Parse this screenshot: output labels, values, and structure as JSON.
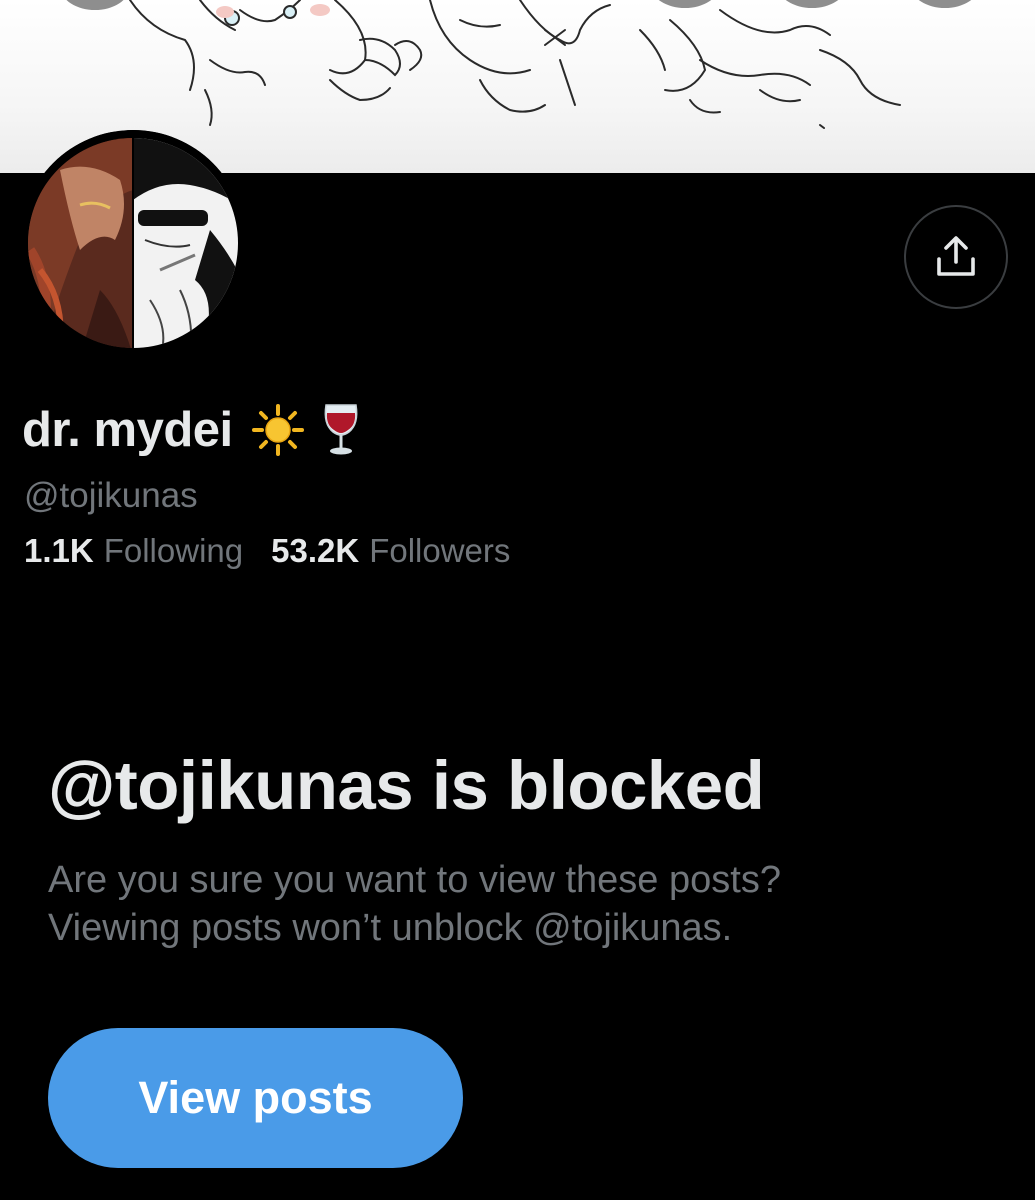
{
  "profile": {
    "display_name": "dr. mydei",
    "name_emojis": [
      "sun-icon",
      "wine-glass-icon"
    ],
    "handle": "@tojikunas",
    "following_count": "1.1K",
    "following_label": "Following",
    "followers_count": "53.2K",
    "followers_label": "Followers"
  },
  "blocked": {
    "title": "@tojikunas is blocked",
    "line1": "Are you sure you want to view these posts?",
    "line2": "Viewing posts won’t unblock @tojikunas.",
    "button_label": "View posts"
  },
  "icons": {
    "share": "share-upload-icon"
  },
  "colors": {
    "background": "#000000",
    "primary_text": "#e7e9ea",
    "secondary_text": "#71767b",
    "button_blue": "#4a9be8"
  }
}
